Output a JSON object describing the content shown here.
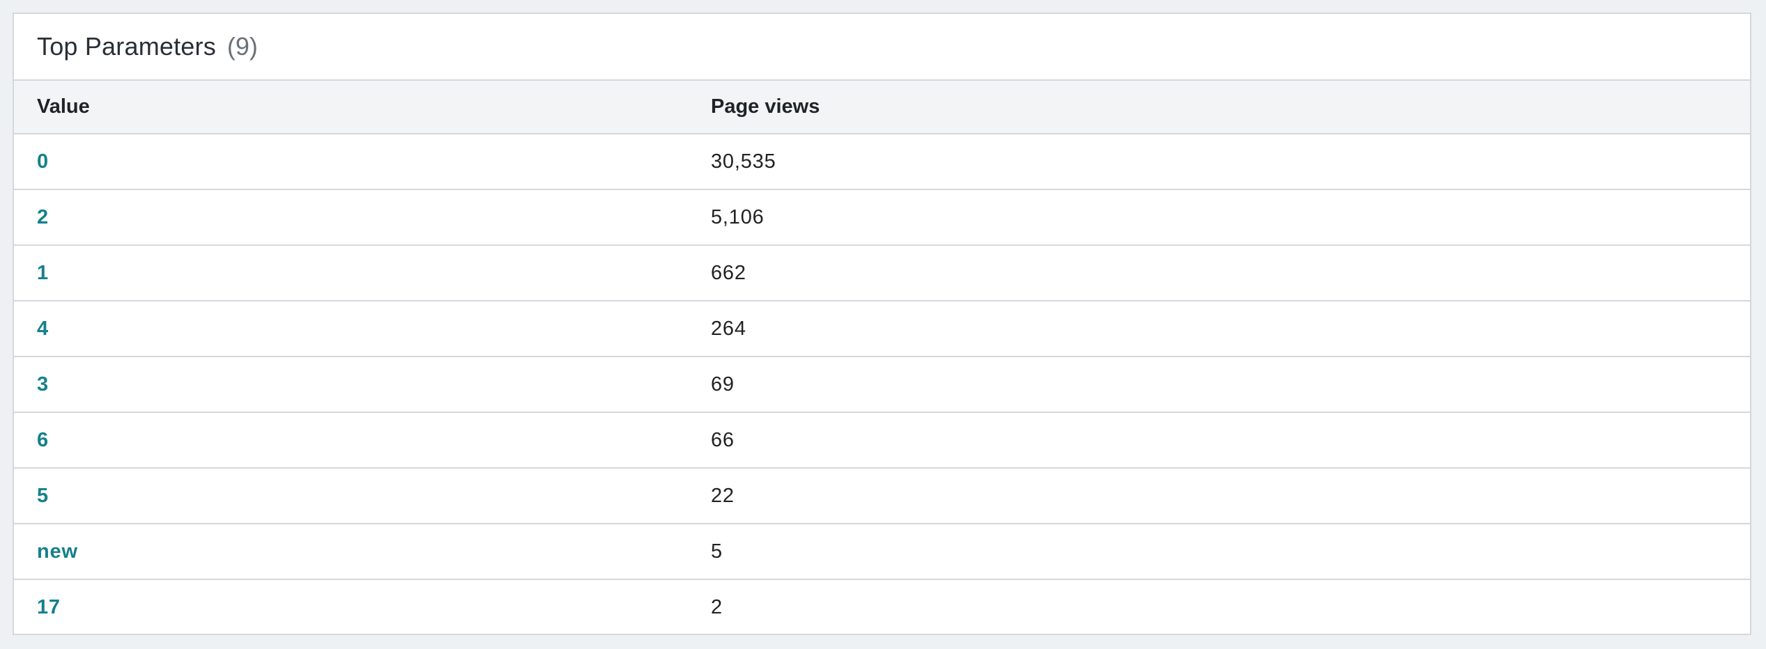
{
  "panel": {
    "title": "Top Parameters",
    "count": "(9)"
  },
  "table": {
    "headers": {
      "value": "Value",
      "views": "Page views"
    },
    "rows": [
      {
        "value": "0",
        "views": "30,535"
      },
      {
        "value": "2",
        "views": "5,106"
      },
      {
        "value": "1",
        "views": "662"
      },
      {
        "value": "4",
        "views": "264"
      },
      {
        "value": "3",
        "views": "69"
      },
      {
        "value": "6",
        "views": "66"
      },
      {
        "value": "5",
        "views": "22"
      },
      {
        "value": "new",
        "views": "5"
      },
      {
        "value": "17",
        "views": "2"
      }
    ]
  },
  "colors": {
    "link": "#16808c",
    "header_bg": "#f3f4f6",
    "border": "#d4d8dd"
  }
}
